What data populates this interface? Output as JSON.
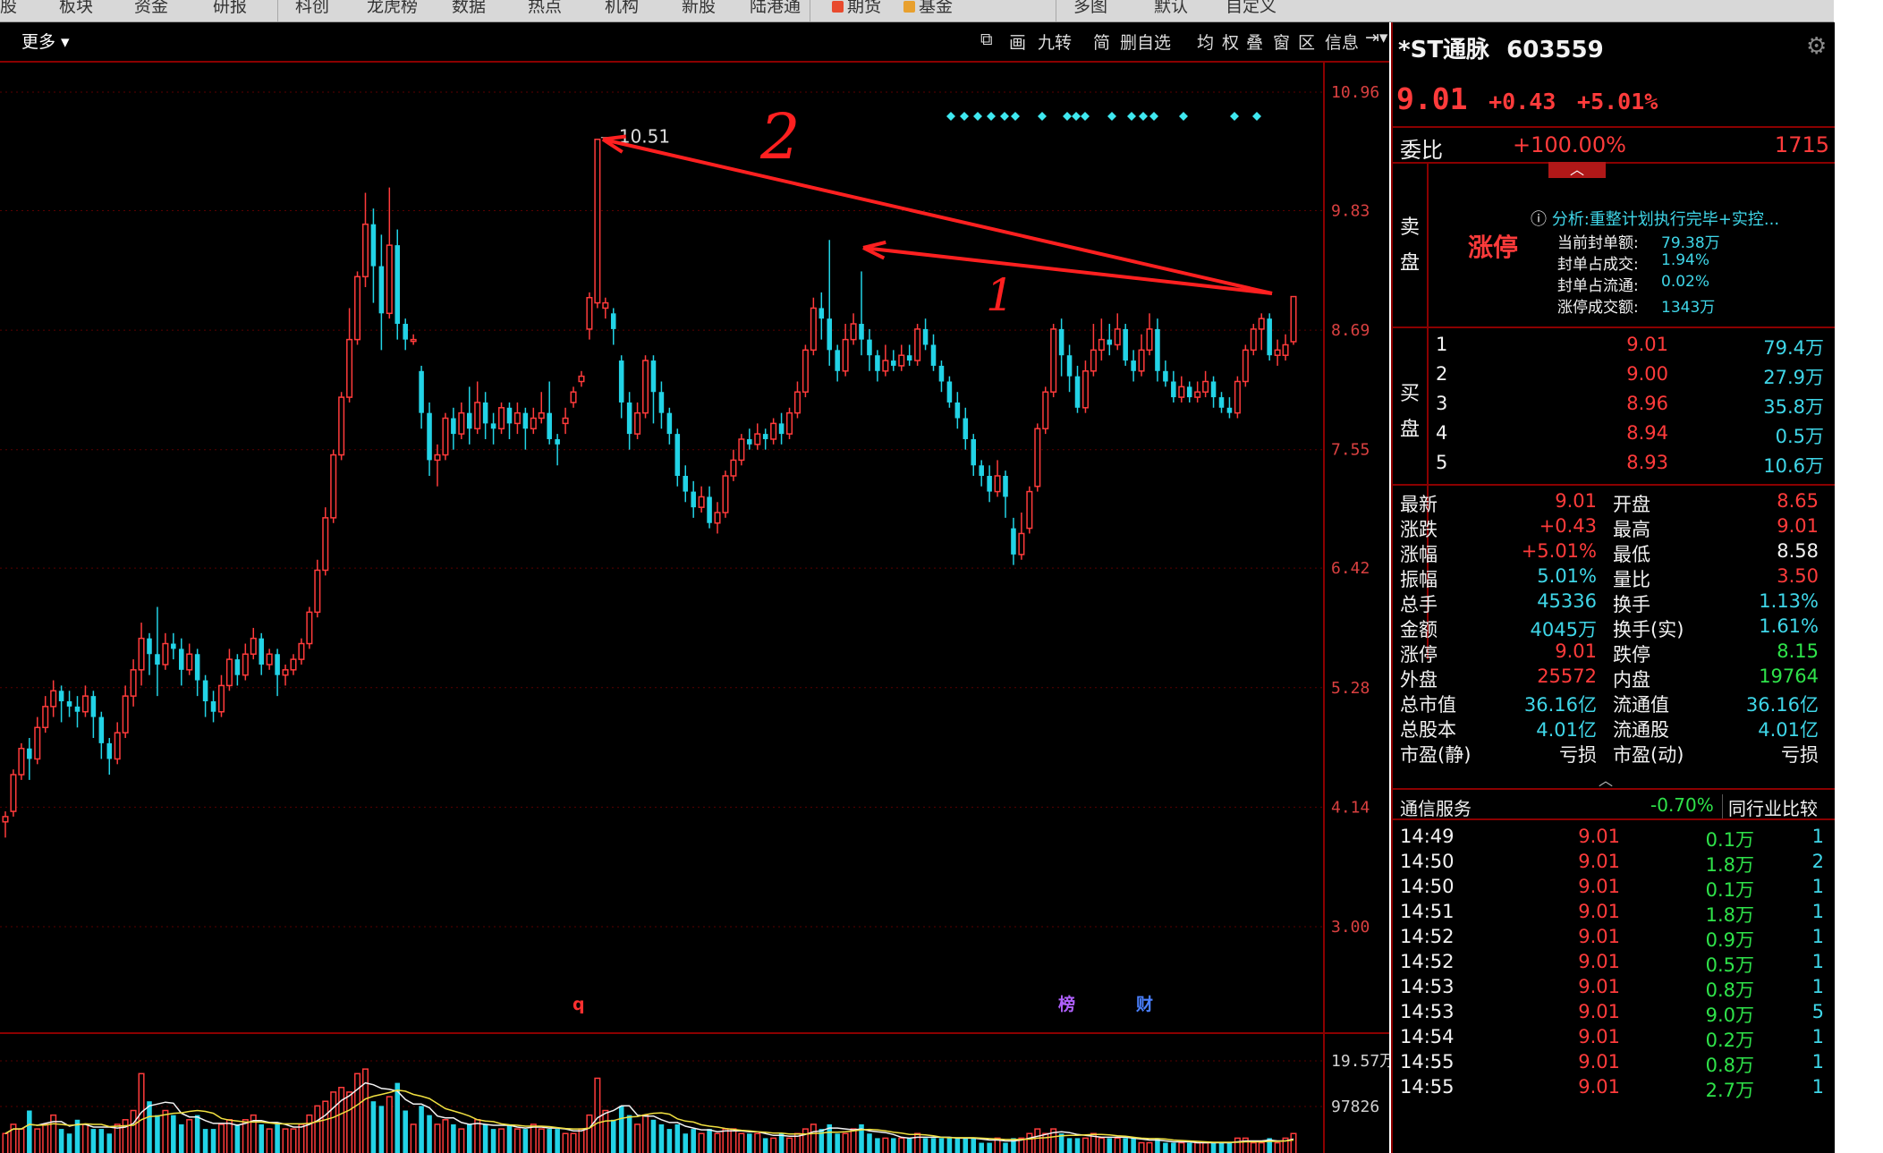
{
  "topnav": {
    "tabs": [
      "股",
      "板块",
      "资金",
      "研报",
      "科创",
      "龙虎榜",
      "数据",
      "热点",
      "机构",
      "新股",
      "陆港通",
      "期货",
      "基金",
      "多图",
      "默认",
      "自定义"
    ]
  },
  "toolbar": {
    "more": "更多 ▾",
    "items": [
      "画",
      "九转",
      "简",
      "删自选",
      "均",
      "权",
      "叠",
      "窗",
      "区",
      "信息"
    ]
  },
  "chart_data": {
    "type": "candlestick",
    "y_ticks": [
      "10.96",
      "9.83",
      "8.69",
      "7.55",
      "6.42",
      "5.28",
      "4.14",
      "3.00"
    ],
    "volume_ticks": [
      "19.57万",
      "97826"
    ],
    "peak_label": "10.51",
    "annotations": [
      "2",
      "1"
    ],
    "markers": [
      "q",
      "榜",
      "财"
    ],
    "colors": {
      "up": "#ff3b3b",
      "down": "#22d3e6",
      "grid": "#5a0000"
    },
    "candles": [
      [
        4.0,
        4.05,
        3.85,
        4.1
      ],
      [
        4.1,
        4.45,
        4.05,
        4.5
      ],
      [
        4.45,
        4.7,
        4.4,
        4.75
      ],
      [
        4.7,
        4.6,
        4.4,
        4.8
      ],
      [
        4.6,
        4.9,
        4.55,
        5.0
      ],
      [
        4.9,
        5.1,
        4.85,
        5.2
      ],
      [
        5.1,
        5.25,
        5.0,
        5.35
      ],
      [
        5.25,
        5.15,
        4.95,
        5.3
      ],
      [
        5.15,
        5.1,
        5.0,
        5.25
      ],
      [
        5.1,
        5.05,
        4.9,
        5.2
      ],
      [
        5.05,
        5.2,
        5.0,
        5.3
      ],
      [
        5.2,
        5.0,
        4.8,
        5.25
      ],
      [
        5.0,
        4.75,
        4.6,
        5.05
      ],
      [
        4.75,
        4.6,
        4.45,
        4.8
      ],
      [
        4.6,
        4.85,
        4.55,
        4.95
      ],
      [
        4.85,
        5.2,
        4.8,
        5.3
      ],
      [
        5.2,
        5.45,
        5.1,
        5.55
      ],
      [
        5.45,
        5.75,
        5.3,
        5.9
      ],
      [
        5.75,
        5.6,
        5.4,
        5.8
      ],
      [
        5.6,
        5.5,
        5.2,
        6.05
      ],
      [
        5.5,
        5.7,
        5.45,
        5.8
      ],
      [
        5.7,
        5.65,
        5.55,
        5.8
      ],
      [
        5.65,
        5.45,
        5.3,
        5.75
      ],
      [
        5.45,
        5.6,
        5.4,
        5.7
      ],
      [
        5.6,
        5.35,
        5.2,
        5.65
      ],
      [
        5.35,
        5.15,
        5.0,
        5.4
      ],
      [
        5.15,
        5.05,
        4.95,
        5.25
      ],
      [
        5.05,
        5.3,
        5.0,
        5.4
      ],
      [
        5.3,
        5.55,
        5.25,
        5.65
      ],
      [
        5.55,
        5.4,
        5.3,
        5.6
      ],
      [
        5.4,
        5.6,
        5.35,
        5.7
      ],
      [
        5.6,
        5.75,
        5.55,
        5.85
      ],
      [
        5.75,
        5.5,
        5.4,
        5.8
      ],
      [
        5.5,
        5.6,
        5.45,
        5.65
      ],
      [
        5.6,
        5.4,
        5.2,
        5.65
      ],
      [
        5.4,
        5.45,
        5.3,
        5.5
      ],
      [
        5.45,
        5.55,
        5.4,
        5.6
      ],
      [
        5.55,
        5.7,
        5.5,
        5.75
      ],
      [
        5.7,
        6.0,
        5.65,
        6.05
      ],
      [
        6.0,
        6.4,
        5.95,
        6.5
      ],
      [
        6.4,
        6.9,
        6.35,
        7.0
      ],
      [
        6.9,
        7.5,
        6.85,
        7.55
      ],
      [
        7.5,
        8.05,
        7.45,
        8.1
      ],
      [
        8.05,
        8.6,
        8.0,
        8.9
      ],
      [
        8.6,
        9.2,
        8.55,
        9.25
      ],
      [
        9.2,
        9.7,
        9.1,
        10.0
      ],
      [
        9.7,
        9.3,
        8.95,
        9.85
      ],
      [
        9.3,
        8.85,
        8.5,
        9.6
      ],
      [
        8.85,
        9.5,
        8.8,
        10.05
      ],
      [
        9.5,
        8.75,
        8.6,
        9.65
      ],
      [
        8.75,
        8.6,
        8.5,
        8.8
      ],
      [
        8.6,
        8.6,
        8.55,
        8.65
      ],
      [
        8.3,
        7.9,
        7.75,
        8.35
      ],
      [
        7.9,
        7.45,
        7.3,
        8.0
      ],
      [
        7.45,
        7.5,
        7.2,
        7.6
      ],
      [
        7.5,
        7.85,
        7.45,
        7.9
      ],
      [
        7.85,
        7.7,
        7.55,
        7.95
      ],
      [
        7.7,
        7.9,
        7.65,
        8.0
      ],
      [
        7.9,
        7.75,
        7.6,
        8.15
      ],
      [
        7.75,
        8.0,
        7.7,
        8.2
      ],
      [
        8.0,
        7.8,
        7.65,
        8.1
      ],
      [
        7.8,
        7.75,
        7.6,
        7.9
      ],
      [
        7.75,
        7.95,
        7.7,
        8.0
      ],
      [
        7.95,
        7.8,
        7.65,
        8.0
      ],
      [
        7.8,
        7.9,
        7.7,
        8.0
      ],
      [
        7.9,
        7.75,
        7.55,
        7.95
      ],
      [
        7.75,
        7.85,
        7.7,
        7.95
      ],
      [
        7.85,
        7.9,
        7.8,
        8.1
      ],
      [
        7.9,
        7.65,
        7.6,
        8.2
      ],
      [
        7.65,
        7.6,
        7.4,
        7.7
      ],
      [
        7.8,
        7.85,
        7.7,
        7.95
      ],
      [
        8.0,
        8.1,
        7.95,
        8.15
      ],
      [
        8.2,
        8.25,
        8.15,
        8.3
      ],
      [
        8.7,
        9.0,
        8.6,
        9.05
      ],
      [
        8.95,
        10.51,
        8.9,
        10.51
      ],
      [
        8.9,
        8.95,
        8.8,
        9.0
      ],
      [
        8.85,
        8.7,
        8.55,
        8.9
      ],
      [
        8.4,
        8.0,
        7.85,
        8.45
      ],
      [
        8.0,
        7.7,
        7.55,
        8.1
      ],
      [
        7.7,
        7.9,
        7.65,
        8.0
      ],
      [
        7.9,
        8.4,
        7.85,
        8.45
      ],
      [
        8.4,
        8.1,
        7.8,
        8.45
      ],
      [
        8.1,
        7.9,
        7.75,
        8.2
      ],
      [
        7.9,
        7.7,
        7.6,
        7.95
      ],
      [
        7.7,
        7.3,
        7.2,
        7.75
      ],
      [
        7.3,
        7.15,
        7.05,
        7.4
      ],
      [
        7.15,
        7.0,
        6.9,
        7.25
      ],
      [
        7.0,
        7.1,
        6.95,
        7.2
      ],
      [
        7.1,
        6.85,
        6.8,
        7.2
      ],
      [
        6.85,
        6.95,
        6.75,
        7.05
      ],
      [
        6.95,
        7.3,
        6.9,
        7.35
      ],
      [
        7.3,
        7.45,
        7.25,
        7.55
      ],
      [
        7.45,
        7.65,
        7.4,
        7.7
      ],
      [
        7.65,
        7.6,
        7.55,
        7.75
      ],
      [
        7.6,
        7.7,
        7.55,
        7.8
      ],
      [
        7.7,
        7.65,
        7.55,
        7.75
      ],
      [
        7.65,
        7.8,
        7.6,
        7.85
      ],
      [
        7.8,
        7.7,
        7.6,
        7.9
      ],
      [
        7.7,
        7.9,
        7.65,
        7.95
      ],
      [
        7.9,
        8.1,
        7.85,
        8.2
      ],
      [
        8.1,
        8.5,
        8.05,
        8.55
      ],
      [
        8.5,
        8.9,
        8.45,
        9.0
      ],
      [
        8.9,
        8.8,
        8.6,
        9.05
      ],
      [
        8.8,
        8.5,
        8.35,
        9.55
      ],
      [
        8.5,
        8.3,
        8.2,
        8.55
      ],
      [
        8.3,
        8.6,
        8.25,
        8.75
      ],
      [
        8.6,
        8.75,
        8.55,
        8.85
      ],
      [
        8.75,
        8.6,
        8.45,
        9.25
      ],
      [
        8.6,
        8.45,
        8.3,
        8.7
      ],
      [
        8.45,
        8.3,
        8.2,
        8.5
      ],
      [
        8.3,
        8.4,
        8.25,
        8.55
      ],
      [
        8.4,
        8.35,
        8.3,
        8.5
      ],
      [
        8.35,
        8.45,
        8.3,
        8.55
      ],
      [
        8.45,
        8.4,
        8.35,
        8.55
      ],
      [
        8.4,
        8.7,
        8.35,
        8.75
      ],
      [
        8.7,
        8.55,
        8.5,
        8.8
      ],
      [
        8.55,
        8.35,
        8.3,
        8.65
      ],
      [
        8.35,
        8.2,
        8.1,
        8.4
      ],
      [
        8.2,
        8.0,
        7.95,
        8.25
      ],
      [
        8.0,
        7.85,
        7.75,
        8.1
      ],
      [
        7.85,
        7.65,
        7.55,
        7.95
      ],
      [
        7.65,
        7.4,
        7.3,
        7.7
      ],
      [
        7.4,
        7.3,
        7.2,
        7.45
      ],
      [
        7.3,
        7.15,
        7.05,
        7.4
      ],
      [
        7.15,
        7.3,
        7.1,
        7.45
      ],
      [
        7.3,
        7.1,
        6.9,
        7.35
      ],
      [
        6.8,
        6.55,
        6.45,
        6.9
      ],
      [
        6.55,
        6.75,
        6.5,
        6.95
      ],
      [
        6.8,
        7.15,
        6.75,
        7.2
      ],
      [
        7.2,
        7.75,
        7.15,
        7.8
      ],
      [
        7.75,
        8.1,
        7.7,
        8.15
      ],
      [
        8.1,
        8.7,
        8.05,
        8.75
      ],
      [
        8.7,
        8.45,
        8.25,
        8.8
      ],
      [
        8.45,
        8.25,
        8.1,
        8.55
      ],
      [
        8.25,
        7.95,
        7.9,
        8.35
      ],
      [
        7.95,
        8.3,
        7.9,
        8.4
      ],
      [
        8.3,
        8.5,
        8.25,
        8.75
      ],
      [
        8.5,
        8.6,
        8.4,
        8.8
      ],
      [
        8.6,
        8.55,
        8.45,
        8.75
      ],
      [
        8.55,
        8.7,
        8.5,
        8.85
      ],
      [
        8.7,
        8.4,
        8.35,
        8.75
      ],
      [
        8.4,
        8.3,
        8.2,
        8.5
      ],
      [
        8.3,
        8.5,
        8.25,
        8.65
      ],
      [
        8.5,
        8.7,
        8.45,
        8.85
      ],
      [
        8.7,
        8.3,
        8.2,
        8.8
      ],
      [
        8.3,
        8.2,
        8.15,
        8.4
      ],
      [
        8.2,
        8.05,
        8.0,
        8.3
      ],
      [
        8.05,
        8.15,
        8.0,
        8.25
      ],
      [
        8.15,
        8.05,
        8.0,
        8.2
      ],
      [
        8.05,
        8.1,
        8.0,
        8.2
      ],
      [
        8.1,
        8.2,
        8.05,
        8.3
      ],
      [
        8.2,
        8.05,
        7.95,
        8.25
      ],
      [
        8.05,
        7.95,
        7.9,
        8.1
      ],
      [
        7.95,
        7.9,
        7.85,
        8.05
      ],
      [
        7.9,
        8.2,
        7.85,
        8.25
      ],
      [
        8.2,
        8.5,
        8.15,
        8.55
      ],
      [
        8.5,
        8.7,
        8.45,
        8.75
      ],
      [
        8.7,
        8.8,
        8.5,
        8.85
      ],
      [
        8.8,
        8.45,
        8.4,
        8.85
      ],
      [
        8.45,
        8.5,
        8.35,
        8.6
      ],
      [
        8.45,
        8.55,
        8.4,
        8.65
      ],
      [
        8.58,
        9.01,
        8.55,
        9.01
      ]
    ],
    "volumes": [
      0.25,
      0.35,
      0.3,
      0.5,
      0.3,
      0.35,
      0.45,
      0.3,
      0.25,
      0.4,
      0.35,
      0.3,
      0.3,
      0.25,
      0.35,
      0.4,
      0.5,
      0.9,
      0.6,
      0.45,
      0.5,
      0.45,
      0.35,
      0.4,
      0.45,
      0.3,
      0.3,
      0.35,
      0.4,
      0.35,
      0.4,
      0.45,
      0.35,
      0.3,
      0.35,
      0.3,
      0.3,
      0.35,
      0.45,
      0.55,
      0.6,
      0.7,
      0.75,
      0.7,
      0.9,
      0.95,
      0.6,
      0.55,
      0.65,
      0.8,
      0.5,
      0.35,
      0.55,
      0.45,
      0.35,
      0.4,
      0.35,
      0.3,
      0.35,
      0.4,
      0.35,
      0.3,
      0.3,
      0.35,
      0.3,
      0.3,
      0.35,
      0.3,
      0.3,
      0.3,
      0.25,
      0.25,
      0.3,
      0.45,
      0.85,
      0.5,
      0.4,
      0.55,
      0.45,
      0.35,
      0.45,
      0.4,
      0.35,
      0.3,
      0.35,
      0.25,
      0.3,
      0.25,
      0.3,
      0.25,
      0.3,
      0.3,
      0.25,
      0.25,
      0.25,
      0.2,
      0.2,
      0.25,
      0.2,
      0.25,
      0.3,
      0.35,
      0.3,
      0.35,
      0.25,
      0.25,
      0.3,
      0.35,
      0.25,
      0.2,
      0.2,
      0.2,
      0.2,
      0.2,
      0.25,
      0.2,
      0.2,
      0.2,
      0.2,
      0.2,
      0.2,
      0.2,
      0.15,
      0.15,
      0.2,
      0.15,
      0.2,
      0.2,
      0.25,
      0.3,
      0.25,
      0.3,
      0.25,
      0.2,
      0.2,
      0.2,
      0.25,
      0.2,
      0.2,
      0.2,
      0.2,
      0.2,
      0.15,
      0.15,
      0.2,
      0.15,
      0.15,
      0.15,
      0.15,
      0.15,
      0.15,
      0.15,
      0.15,
      0.15,
      0.2,
      0.2,
      0.15,
      0.15,
      0.2,
      0.15,
      0.2,
      0.25
    ]
  },
  "panel": {
    "stock_name": "*ST通脉",
    "stock_code": "603559",
    "price": "9.01",
    "change": "+0.43",
    "change_pct": "+5.01%",
    "ratio_label": "委比",
    "ratio_value": "+100.00%",
    "ratio_num": "1715",
    "sell_label": "卖盘",
    "limit_up": "涨停",
    "analysis": "分析:重整计划执行完毕+实控...",
    "analysis_lines": [
      {
        "k": "当前封单额:",
        "v": "79.38万"
      },
      {
        "k": "封单占成交:",
        "v": "1.94%"
      },
      {
        "k": "封单占流通:",
        "v": "0.02%"
      },
      {
        "k": "涨停成交额:",
        "v": "1343万"
      }
    ],
    "buy_label": "买盘",
    "bids": [
      {
        "n": "1",
        "p": "9.01",
        "v": "79.4万"
      },
      {
        "n": "2",
        "p": "9.00",
        "v": "27.9万"
      },
      {
        "n": "3",
        "p": "8.96",
        "v": "35.8万"
      },
      {
        "n": "4",
        "p": "8.94",
        "v": "0.5万"
      },
      {
        "n": "5",
        "p": "8.93",
        "v": "10.6万"
      }
    ],
    "quote": [
      {
        "k1": "最新",
        "v1": "9.01",
        "c1": "red",
        "k2": "开盘",
        "v2": "8.65",
        "c2": "red"
      },
      {
        "k1": "涨跌",
        "v1": "+0.43",
        "c1": "red",
        "k2": "最高",
        "v2": "9.01",
        "c2": "red"
      },
      {
        "k1": "涨幅",
        "v1": "+5.01%",
        "c1": "red",
        "k2": "最低",
        "v2": "8.58",
        "c2": "white"
      },
      {
        "k1": "振幅",
        "v1": "5.01%",
        "c1": "cyan",
        "k2": "量比",
        "v2": "3.50",
        "c2": "red"
      },
      {
        "k1": "总手",
        "v1": "45336",
        "c1": "cyan",
        "k2": "换手",
        "v2": "1.13%",
        "c2": "cyan"
      },
      {
        "k1": "金额",
        "v1": "4045万",
        "c1": "cyan",
        "k2": "换手(实)",
        "v2": "1.61%",
        "c2": "cyan"
      },
      {
        "k1": "涨停",
        "v1": "9.01",
        "c1": "red",
        "k2": "跌停",
        "v2": "8.15",
        "c2": "green"
      },
      {
        "k1": "外盘",
        "v1": "25572",
        "c1": "red",
        "k2": "内盘",
        "v2": "19764",
        "c2": "green"
      },
      {
        "k1": "总市值",
        "v1": "36.16亿",
        "c1": "cyan",
        "k2": "流通值",
        "v2": "36.16亿",
        "c2": "cyan"
      },
      {
        "k1": "总股本",
        "v1": "4.01亿",
        "c1": "cyan",
        "k2": "流通股",
        "v2": "4.01亿",
        "c2": "cyan"
      },
      {
        "k1": "市盈(静)",
        "v1": "亏损",
        "c1": "white",
        "k2": "市盈(动)",
        "v2": "亏损",
        "c2": "white"
      }
    ],
    "industry": "通信服务",
    "industry_pct": "-0.70%",
    "industry_btn": "同行业比较",
    "ticks": [
      {
        "t": "14:49",
        "p": "9.01",
        "v": "0.1万",
        "n": "1"
      },
      {
        "t": "14:50",
        "p": "9.01",
        "v": "1.8万",
        "n": "2"
      },
      {
        "t": "14:50",
        "p": "9.01",
        "v": "0.1万",
        "n": "1"
      },
      {
        "t": "14:51",
        "p": "9.01",
        "v": "1.8万",
        "n": "1"
      },
      {
        "t": "14:52",
        "p": "9.01",
        "v": "0.9万",
        "n": "1"
      },
      {
        "t": "14:52",
        "p": "9.01",
        "v": "0.5万",
        "n": "1"
      },
      {
        "t": "14:53",
        "p": "9.01",
        "v": "0.8万",
        "n": "1"
      },
      {
        "t": "14:53",
        "p": "9.01",
        "v": "9.0万",
        "n": "5"
      },
      {
        "t": "14:54",
        "p": "9.01",
        "v": "0.2万",
        "n": "1"
      },
      {
        "t": "14:55",
        "p": "9.01",
        "v": "0.8万",
        "n": "1"
      },
      {
        "t": "14:55",
        "p": "9.01",
        "v": "2.7万",
        "n": "1"
      }
    ]
  }
}
